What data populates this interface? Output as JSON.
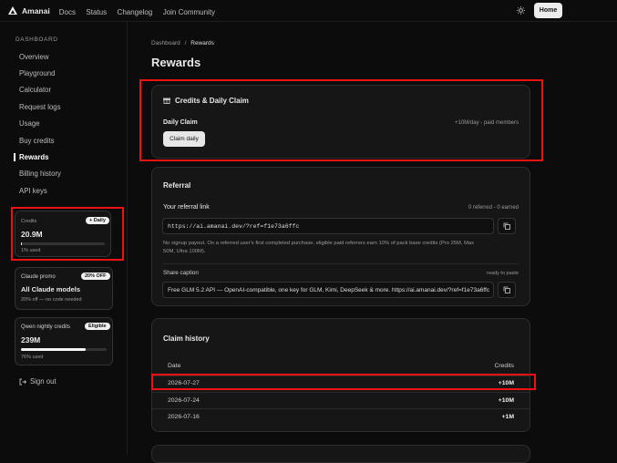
{
  "topbar": {
    "brand": "Amanai",
    "nav": [
      "Docs",
      "Status",
      "Changelog",
      "Join Community"
    ],
    "home_label": "Home"
  },
  "sidebar": {
    "heading": "DASHBOARD",
    "items": [
      "Overview",
      "Playground",
      "Calculator",
      "Request logs",
      "Usage",
      "Buy credits",
      "Rewards",
      "Billing history",
      "API keys"
    ],
    "active": "Rewards",
    "credits": {
      "label": "Credits",
      "badge": "+ Daily",
      "value": "20.9M",
      "used": "1% used",
      "fraction": 0.01
    },
    "promo": {
      "label": "Claude promo",
      "badge": "20% OFF",
      "title": "All Claude models",
      "note": "20% off — no code needed"
    },
    "qwen": {
      "label": "Qwen nightly credits",
      "badge": "Eligible",
      "value": "239M",
      "used": "76% used",
      "fraction": 0.76
    },
    "signout": "Sign out"
  },
  "breadcrumb": {
    "parent": "Dashboard",
    "sep": "/",
    "current": "Rewards"
  },
  "page_title": "Rewards",
  "daily": {
    "title": "Credits & Daily Claim",
    "label": "Daily Claim",
    "note": "+10M/day - paid members",
    "button": "Claim daily"
  },
  "referral": {
    "title": "Referral",
    "link_label": "Your referral link",
    "stats": "0 referred - 0 earned",
    "link": "https://ai.amanai.dev/?ref=f1e73a6ffc",
    "desc1": "No signup payout. On a referred user's first completed purchase, eligible paid referrers earn 10% of pack base credits (Pro 25M, Max",
    "desc2": "50M, Ultra 100M).",
    "caption_label": "Share caption",
    "caption_status": "ready to paste",
    "caption": "Free GLM 5.2 API — OpenAI-compatible, one key for GLM, Kimi, DeepSeek & more. https://ai.amanai.dev/?ref=f1e73a6ffc"
  },
  "history": {
    "title": "Claim history",
    "col_date": "Date",
    "col_credits": "Credits",
    "rows": [
      {
        "date": "2026-07-27",
        "credits": "+10M"
      },
      {
        "date": "2026-07-24",
        "credits": "+10M"
      },
      {
        "date": "2026-07-16",
        "credits": "+1M"
      }
    ]
  }
}
